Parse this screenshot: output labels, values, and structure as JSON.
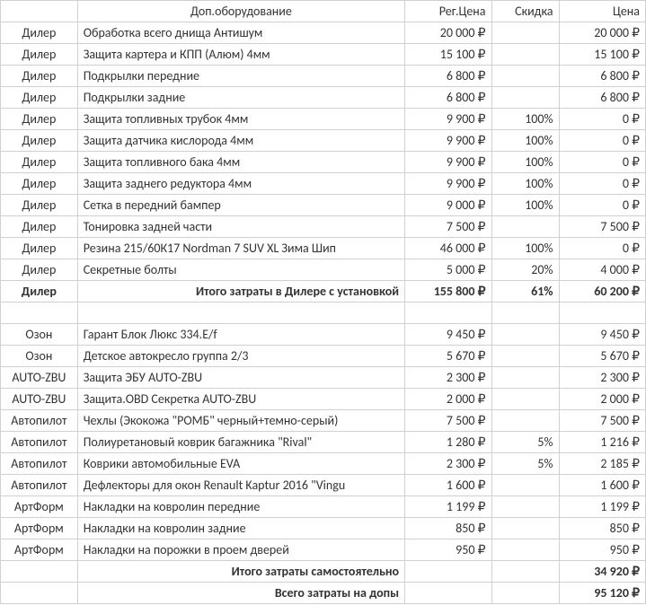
{
  "headers": {
    "name": "Доп.оборудование",
    "reg": "Рег.Цена",
    "disc": "Скидка",
    "price": "Цена"
  },
  "dealer_rows": [
    {
      "src": "Дилер",
      "name": "Обработка всего днища Антишум",
      "reg": "20 000 ₽",
      "disc": "",
      "price": "20 000 ₽"
    },
    {
      "src": "Дилер",
      "name": "Защита картера и КПП (Алюм) 4мм",
      "reg": "15 100 ₽",
      "disc": "",
      "price": "15 100 ₽"
    },
    {
      "src": "Дилер",
      "name": "Подкрылки передние",
      "reg": "6 800 ₽",
      "disc": "",
      "price": "6 800 ₽"
    },
    {
      "src": "Дилер",
      "name": "Подкрылки задние",
      "reg": "6 800 ₽",
      "disc": "",
      "price": "6 800 ₽"
    },
    {
      "src": "Дилер",
      "name": "Защита топливных трубок 4мм",
      "reg": "9 900 ₽",
      "disc": "100%",
      "price": "0 ₽"
    },
    {
      "src": "Дилер",
      "name": "Защита датчика кислорода 4мм",
      "reg": "9 900 ₽",
      "disc": "100%",
      "price": "0 ₽"
    },
    {
      "src": "Дилер",
      "name": "Защита топливного бака 4мм",
      "reg": "9 900 ₽",
      "disc": "100%",
      "price": "0 ₽"
    },
    {
      "src": "Дилер",
      "name": "Защита заднего редуктора 4мм",
      "reg": "9 900 ₽",
      "disc": "100%",
      "price": "0 ₽"
    },
    {
      "src": "Дилер",
      "name": "Сетка в передний бампер",
      "reg": "9 000 ₽",
      "disc": "100%",
      "price": "0 ₽"
    },
    {
      "src": "Дилер",
      "name": "Тонировка задней части",
      "reg": "7 500 ₽",
      "disc": "",
      "price": "7 500 ₽"
    },
    {
      "src": "Дилер",
      "name": "Резина 215/60К17 Nordman 7 SUV  XL Зима Шип",
      "reg": "46 000 ₽",
      "disc": "100%",
      "price": "0 ₽"
    },
    {
      "src": "Дилер",
      "name": "Секретные болты",
      "reg": "5 000 ₽",
      "disc": "20%",
      "price": "4 000 ₽"
    }
  ],
  "dealer_total": {
    "src": "Дилер",
    "name": "Итого затраты в Дилере с установкой",
    "reg": "155 800 ₽",
    "disc": "61%",
    "price": "60 200 ₽"
  },
  "self_rows": [
    {
      "src": "Озон",
      "name": "Гарант Блок Люкс 334.E/f",
      "reg": "9 450 ₽",
      "disc": "",
      "price": "9 450 ₽"
    },
    {
      "src": "Озон",
      "name": "Детское автокресло группа 2/3",
      "reg": "5 670 ₽",
      "disc": "",
      "price": "5 670 ₽"
    },
    {
      "src": "AUTO-ZBU",
      "name": "Защита ЭБУ AUTO-ZBU",
      "reg": "2 300 ₽",
      "disc": "",
      "price": "2 300 ₽"
    },
    {
      "src": "AUTO-ZBU",
      "name": "Защита.OBD Секретка AUTO-ZBU",
      "reg": "2 000 ₽",
      "disc": "",
      "price": "2 000 ₽"
    },
    {
      "src": "Автопилот",
      "name": "Чехлы  (Экокожа \"РОМБ\" черный+темно-серый)",
      "reg": "7 500 ₽",
      "disc": "",
      "price": "7 500 ₽"
    },
    {
      "src": "Автопилот",
      "name": "Полиуретановый коврик багажника \"Rival\"",
      "reg": "1 280 ₽",
      "disc": "5%",
      "price": "1 216 ₽"
    },
    {
      "src": "Автопилот",
      "name": "Коврики автомобильные EVA",
      "reg": "2 300 ₽",
      "disc": "5%",
      "price": "2 185 ₽"
    },
    {
      "src": "Автопилот",
      "name": "Дефлекторы для окон Renault Kaptur 2016 \"Vingu",
      "reg": "1 600 ₽",
      "disc": "",
      "price": "1 600 ₽"
    },
    {
      "src": "АртФорм",
      "name": "Накладки на ковролин передние",
      "reg": "1 199 ₽",
      "disc": "",
      "price": "1 199 ₽"
    },
    {
      "src": "АртФорм",
      "name": "Накладки на ковролин задние",
      "reg": "850 ₽",
      "disc": "",
      "price": "850 ₽"
    },
    {
      "src": "АртФорм",
      "name": "Накладки на порожки в проем дверей",
      "reg": "950 ₽",
      "disc": "",
      "price": "950 ₽"
    }
  ],
  "self_total": {
    "name": "Итого затраты самостоятельно",
    "price": "34 920 ₽"
  },
  "grand_total": {
    "name": "Всего затраты на допы",
    "price": "95 120 ₽"
  }
}
